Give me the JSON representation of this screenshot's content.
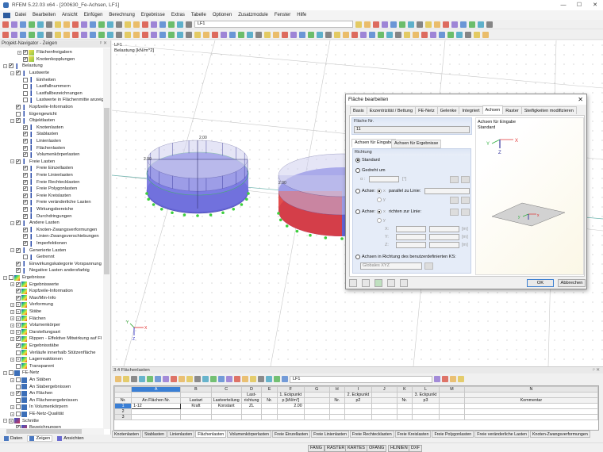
{
  "window": {
    "title": "RFEM 5.22.03 x64 - [200630_Fe-Achsen, LF1]",
    "controls": [
      "—",
      "☐",
      "✕"
    ]
  },
  "menu": [
    "Datei",
    "Bearbeiten",
    "Ansicht",
    "Einfügen",
    "Berechnung",
    "Ergebnisse",
    "Extras",
    "Tabelle",
    "Optionen",
    "Zusatzmodule",
    "Fenster",
    "Hilfe"
  ],
  "toolbar": {
    "loadcase": "LF1"
  },
  "navigator": {
    "title": "Projekt-Navigator - Zeigen",
    "tabs": [
      "Daten",
      "Zeigen",
      "Ansichten"
    ],
    "items": [
      {
        "label": "Flächenfreigaben",
        "level": 2,
        "exp": "+",
        "cb": "on",
        "icon": "check"
      },
      {
        "label": "Knotenkopplungen",
        "level": 2,
        "exp": "",
        "cb": "on",
        "icon": "check"
      },
      {
        "label": "Belastung",
        "level": 0,
        "exp": "-",
        "cb": "on",
        "icon": "load"
      },
      {
        "label": "Lastwerte",
        "level": 1,
        "exp": "-",
        "cb": "on",
        "icon": "load"
      },
      {
        "label": "Einheiten",
        "level": 2,
        "exp": "",
        "cb": "off",
        "icon": "load"
      },
      {
        "label": "Lastfallnummern",
        "level": 2,
        "exp": "",
        "cb": "off",
        "icon": "load"
      },
      {
        "label": "Lastfallbezeichnungen",
        "level": 2,
        "exp": "",
        "cb": "off",
        "icon": "load"
      },
      {
        "label": "Lastwerte in Flächenmitte anzeigen",
        "level": 2,
        "exp": "",
        "cb": "off",
        "icon": "load"
      },
      {
        "label": "Kopfzeile-Information",
        "level": 1,
        "exp": "",
        "cb": "on",
        "icon": "load"
      },
      {
        "label": "Eigengewicht",
        "level": 1,
        "exp": "",
        "cb": "off",
        "icon": "load"
      },
      {
        "label": "Objektlasten",
        "level": 1,
        "exp": "-",
        "cb": "on",
        "icon": "load"
      },
      {
        "label": "Knotenlasten",
        "level": 2,
        "exp": "",
        "cb": "on",
        "icon": "load"
      },
      {
        "label": "Stablasten",
        "level": 2,
        "exp": "",
        "cb": "on",
        "icon": "load"
      },
      {
        "label": "Linienlasten",
        "level": 2,
        "exp": "",
        "cb": "on",
        "icon": "load"
      },
      {
        "label": "Flächenlasten",
        "level": 2,
        "exp": "",
        "cb": "on",
        "icon": "load"
      },
      {
        "label": "Volumenkörperlasten",
        "level": 2,
        "exp": "",
        "cb": "on",
        "icon": "load"
      },
      {
        "label": "Freie Lasten",
        "level": 1,
        "exp": "-",
        "cb": "on",
        "icon": "load"
      },
      {
        "label": "Freie Einzellasten",
        "level": 2,
        "exp": "",
        "cb": "on",
        "icon": "load"
      },
      {
        "label": "Freie Linienlasten",
        "level": 2,
        "exp": "",
        "cb": "on",
        "icon": "load"
      },
      {
        "label": "Freie Rechtecklasten",
        "level": 2,
        "exp": "",
        "cb": "on",
        "icon": "load"
      },
      {
        "label": "Freie Polygonlasten",
        "level": 2,
        "exp": "",
        "cb": "on",
        "icon": "load"
      },
      {
        "label": "Freie Kreislasten",
        "level": 2,
        "exp": "",
        "cb": "on",
        "icon": "load"
      },
      {
        "label": "Freie veränderliche Lasten",
        "level": 2,
        "exp": "",
        "cb": "on",
        "icon": "load"
      },
      {
        "label": "Wirkungsbereiche",
        "level": 2,
        "exp": "",
        "cb": "on",
        "icon": "load"
      },
      {
        "label": "Durchdringungen",
        "level": 2,
        "exp": "",
        "cb": "on",
        "icon": "load"
      },
      {
        "label": "Andere Lasten",
        "level": 1,
        "exp": "-",
        "cb": "on",
        "icon": "load"
      },
      {
        "label": "Knoten-Zwangsverformungen",
        "level": 2,
        "exp": "",
        "cb": "on",
        "icon": "load"
      },
      {
        "label": "Linien-Zwangsverschiebungen",
        "level": 2,
        "exp": "",
        "cb": "on",
        "icon": "load"
      },
      {
        "label": "Imperfektionen",
        "level": 2,
        "exp": "",
        "cb": "on",
        "icon": "load"
      },
      {
        "label": "Generierte Lasten",
        "level": 1,
        "exp": "-",
        "cb": "on",
        "icon": "load"
      },
      {
        "label": "Getrennt",
        "level": 2,
        "exp": "",
        "cb": "off",
        "icon": "load"
      },
      {
        "label": "Einwirkungskategorie Vorspannung",
        "level": 1,
        "exp": "",
        "cb": "on",
        "icon": "load"
      },
      {
        "label": "Negative Lasten andersfarbig",
        "level": 1,
        "exp": "",
        "cb": "on",
        "icon": "load"
      },
      {
        "label": "Ergebnisse",
        "level": 0,
        "exp": "-",
        "cb": "off",
        "icon": "result"
      },
      {
        "label": "Ergebniswerte",
        "level": 1,
        "exp": "+",
        "cb": "on",
        "icon": "result"
      },
      {
        "label": "Kopfzeile-Information",
        "level": 1,
        "exp": "",
        "cb": "on",
        "icon": "result"
      },
      {
        "label": "Max/Min-Info",
        "level": 1,
        "exp": "",
        "cb": "on",
        "icon": "result"
      },
      {
        "label": "Verformung",
        "level": 1,
        "exp": "+",
        "cb": "partial",
        "icon": "result"
      },
      {
        "label": "Stäbe",
        "level": 1,
        "exp": "+",
        "cb": "partial",
        "icon": "result"
      },
      {
        "label": "Flächen",
        "level": 1,
        "exp": "+",
        "cb": "partial",
        "icon": "result"
      },
      {
        "label": "Volumenkörper",
        "level": 1,
        "exp": "+",
        "cb": "partial",
        "icon": "result"
      },
      {
        "label": "Darstellungsart",
        "level": 1,
        "exp": "+",
        "cb": "partial",
        "icon": "result"
      },
      {
        "label": "Rippen - Effektive Mitwirkung auf Fl",
        "level": 1,
        "exp": "+",
        "cb": "on",
        "icon": "result"
      },
      {
        "label": "Ergebnisstäbe",
        "level": 1,
        "exp": "",
        "cb": "on",
        "icon": "result"
      },
      {
        "label": "Verläufe innerhalb Stützenfläche",
        "level": 1,
        "exp": "",
        "cb": "off",
        "icon": "result"
      },
      {
        "label": "Lagerreaktionen",
        "level": 1,
        "exp": "+",
        "cb": "partial",
        "icon": "result"
      },
      {
        "label": "Transparent",
        "level": 1,
        "exp": "",
        "cb": "off",
        "icon": "result"
      },
      {
        "label": "FE-Netz",
        "level": 0,
        "exp": "-",
        "cb": "off",
        "icon": "mesh"
      },
      {
        "label": "An Stäben",
        "level": 1,
        "exp": "+",
        "cb": "off",
        "icon": "mesh"
      },
      {
        "label": "An Stabergebnissen",
        "level": 1,
        "exp": "",
        "cb": "off",
        "icon": "mesh"
      },
      {
        "label": "An Flächen",
        "level": 1,
        "exp": "+",
        "cb": "on",
        "icon": "mesh"
      },
      {
        "label": "An Flächenergebnissen",
        "level": 1,
        "exp": "",
        "cb": "off",
        "icon": "mesh"
      },
      {
        "label": "In Volumenkörpern",
        "level": 1,
        "exp": "+",
        "cb": "off",
        "icon": "mesh"
      },
      {
        "label": "FE-Netz-Qualität",
        "level": 1,
        "exp": "+",
        "cb": "off",
        "icon": "mesh"
      },
      {
        "label": "Schnitte",
        "level": 0,
        "exp": "-",
        "cb": "partial",
        "icon": "cut"
      },
      {
        "label": "Bezeichnungen",
        "level": 1,
        "exp": "",
        "cb": "on",
        "icon": "cut"
      }
    ]
  },
  "view": {
    "loadcase": "LF1",
    "subtitle": "Belastung [kN/m^2]",
    "load_value": "2.00",
    "axes": {
      "x": "X",
      "y": "Y",
      "z": "Z"
    }
  },
  "dialog": {
    "title": "Fläche bearbeiten",
    "tabs": [
      "Basis",
      "Exzentrizität / Bettung",
      "FE-Netz",
      "Gelenke",
      "Integriert",
      "Achsen",
      "Raster",
      "Steifigkeiten modifizieren"
    ],
    "active_tab": "Achsen",
    "surface_no_label": "Fläche Nr.",
    "surface_no": "11",
    "subtabs": [
      "Achsen für Eingabe",
      "Achsen für Ergebnisse"
    ],
    "direction_label": "Richtung",
    "opt_standard": "Standard",
    "opt_rotated": "Gedreht um",
    "alpha_label": "α :",
    "unit_deg": "[°]",
    "opt_axis1": "Achse:",
    "x_label": "x",
    "y_label": "y",
    "parallel_line": "parallel zu Linie:",
    "opt_axis2": "Achse:",
    "towards_line": "richten zur Linie:",
    "X": "X:",
    "Y": "Y:",
    "Z": "Z:",
    "unit_m": "[m]",
    "opt_ucs": "Achsen in Richtung des benutzerdefinierten KS:",
    "ucs_value": "Globales XYZ",
    "preview_title": "Achsen für Eingabe",
    "preview_sub": "Standard",
    "ok": "OK",
    "cancel": "Abbrechen"
  },
  "table": {
    "title": "3.4 Flächenlasten",
    "loadcase": "LF1",
    "col_letters": [
      "A",
      "B",
      "C",
      "D",
      "E",
      "F",
      "G",
      "H",
      "I",
      "J",
      "K",
      "L",
      "M",
      "N"
    ],
    "group_headers": {
      "D": "Last-",
      "F": "1. Eckpunkt",
      "I": "2. Eckpunkt",
      "L": "3. Eckpunkt"
    },
    "headers": [
      "Nr.",
      "An Flächen Nr.",
      "Lastart",
      "Lastverteilung",
      "richtung",
      "Nr.",
      "p [kN/m²]",
      "",
      "Nr.",
      "p2",
      "",
      "Nr.",
      "p3",
      "",
      "Kommentar"
    ],
    "rows": [
      [
        "1",
        "1-12",
        "Kraft",
        "Konstant",
        "ZL",
        "",
        "2.00",
        "",
        "",
        "",
        "",
        "",
        "",
        "",
        ""
      ],
      [
        "2",
        "",
        "",
        "",
        "",
        "",
        "",
        "",
        "",
        "",
        "",
        "",
        "",
        "",
        ""
      ],
      [
        "3",
        "",
        "",
        "",
        "",
        "",
        "",
        "",
        "",
        "",
        "",
        "",
        "",
        "",
        ""
      ]
    ],
    "tabs": [
      "Knotenlasten",
      "Stablasten",
      "Linienlasten",
      "Flächenlasten",
      "Volumenkörperlasten",
      "Freie Einzellasten",
      "Freie Linienlasten",
      "Freie Rechtecklasten",
      "Freie Kreislasten",
      "Freie Polygonlasten",
      "Freie veränderliche Lasten",
      "Knoten-Zwangsverformungen"
    ],
    "active_tab": "Flächenlasten"
  },
  "status": [
    "FANG",
    "RASTER",
    "KARTES",
    "OFANG",
    "HLINIEN",
    "DXF"
  ]
}
